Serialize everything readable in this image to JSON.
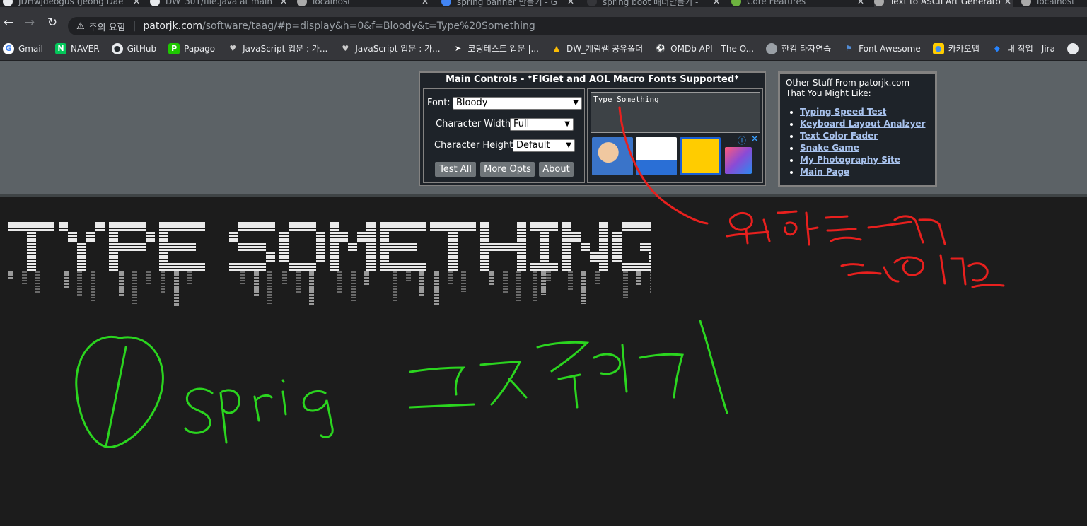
{
  "browser": {
    "tabs": [
      {
        "title": "JDHwjdeogus (Jeong Dae",
        "active": false
      },
      {
        "title": "DW_301/file.java at main",
        "active": false
      },
      {
        "title": "localhost",
        "active": false
      },
      {
        "title": "spring banner 만들기 - G",
        "active": false
      },
      {
        "title": "spring boot 배너만들기 -",
        "active": false
      },
      {
        "title": "Core Features",
        "active": false
      },
      {
        "title": "Text to ASCII Art Generato",
        "active": true
      },
      {
        "title": "localhost",
        "active": false
      }
    ],
    "address": {
      "security_label": "주의 요함",
      "domain": "patorjk.com",
      "path": "/software/taag/#p=display&h=0&f=Bloody&t=Type%20Something"
    },
    "bookmarks": [
      {
        "label": "Gmail",
        "icon": "google-icon"
      },
      {
        "label": "NAVER",
        "icon": "naver-icon"
      },
      {
        "label": "GitHub",
        "icon": "github-icon"
      },
      {
        "label": "Papago",
        "icon": "papago-icon"
      },
      {
        "label": "JavaScript 입문 : 가...",
        "icon": "heart-icon"
      },
      {
        "label": "JavaScript 입문 : 가...",
        "icon": "heart-icon"
      },
      {
        "label": "코딩테스트 입문 |...",
        "icon": "programmers-icon"
      },
      {
        "label": "DW_계림쌤 공유폴더",
        "icon": "drive-icon"
      },
      {
        "label": "OMDb API - The O...",
        "icon": "omdb-icon"
      },
      {
        "label": "한컴 타자연습",
        "icon": "globe-icon"
      },
      {
        "label": "Font Awesome",
        "icon": "flag-icon"
      },
      {
        "label": "카카오맵",
        "icon": "kakaomap-icon"
      },
      {
        "label": "내 작업 - Jira",
        "icon": "jira-icon"
      }
    ]
  },
  "main_controls": {
    "title": "Main Controls - *FIGlet and AOL Macro Fonts Supported*",
    "font_label": "Font:",
    "font_value": "Bloody",
    "char_width_label": "Character Width:",
    "char_width_value": "Full",
    "char_height_label": "Character Height:",
    "char_height_value": "Default",
    "buttons": {
      "test_all": "Test All",
      "more_opts": "More Opts",
      "about": "About"
    },
    "input_text": "Type Something"
  },
  "other_stuff": {
    "title": "Other Stuff From patorjk.com That You Might Like:",
    "links": [
      "Typing Speed Test",
      "Keyboard Layout Analzyer",
      "Text Color Fader",
      "Snake Game",
      "My Photography Site",
      "Main Page"
    ]
  },
  "ascii_output": {
    "text": "TYPE SOMETHING",
    "font": "Bloody"
  },
  "annotations": {
    "red_handwriting": "원하는거 글이면",
    "green_handwriting": "spriq 그거 꾸미기",
    "green_circled_number": "1"
  },
  "colors": {
    "page_bg": "#1c1c1c",
    "top_band": "#5c6266",
    "panel_bg": "#1e2329",
    "link": "#a9c3ee",
    "red_annotation": "#e8201e",
    "green_annotation": "#2bd51f"
  }
}
